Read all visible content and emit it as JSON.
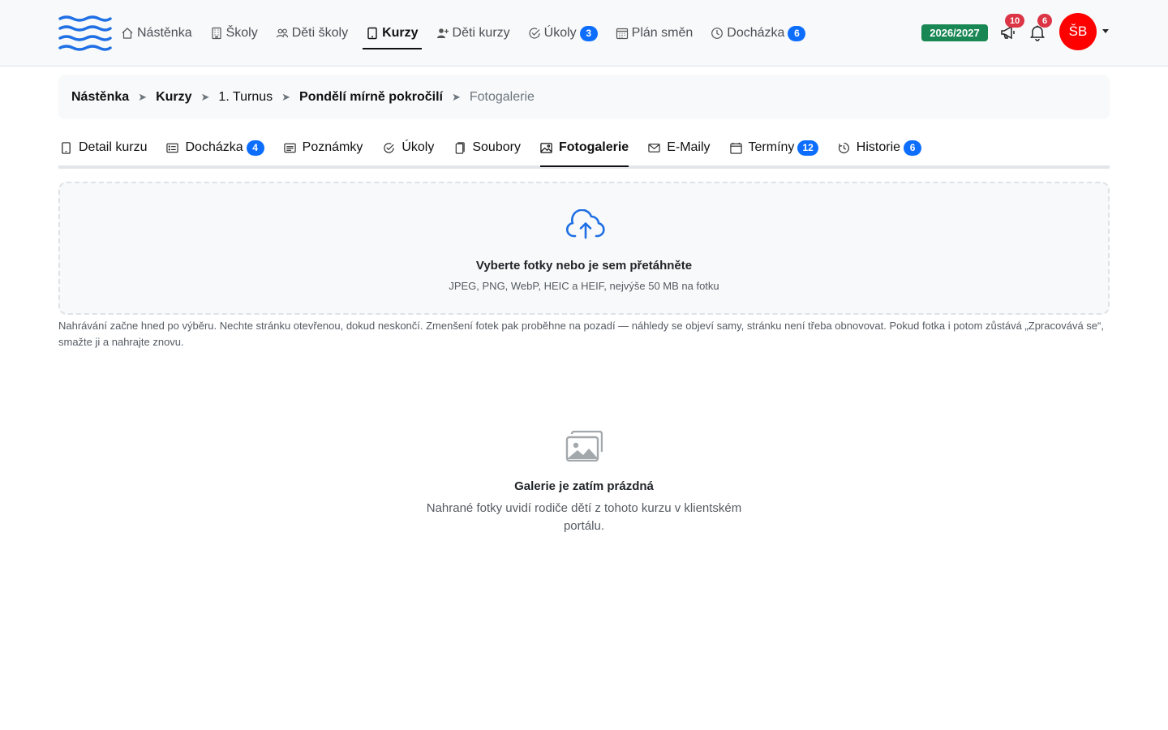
{
  "nav": {
    "items": [
      {
        "label": "Nástěnka",
        "icon": "house-icon"
      },
      {
        "label": "Školy",
        "icon": "building-icon"
      },
      {
        "label": "Děti školy",
        "icon": "people-icon"
      },
      {
        "label": "Kurzy",
        "icon": "tablet-icon",
        "active": true
      },
      {
        "label": "Děti kurzy",
        "icon": "person-plus-icon"
      },
      {
        "label": "Úkoly",
        "icon": "check-circle-icon",
        "badge": "3"
      },
      {
        "label": "Plán směn",
        "icon": "calendar-grid-icon"
      },
      {
        "label": "Docházka",
        "icon": "clock-icon",
        "badge": "6"
      }
    ],
    "year": "2026/2027",
    "announcements_count": "10",
    "notifications_count": "6",
    "avatar_initials": "ŠB"
  },
  "breadcrumb": [
    {
      "label": "Nástěnka"
    },
    {
      "label": "Kurzy"
    },
    {
      "label": "1. Turnus"
    },
    {
      "label": "Pondělí mírně pokročilí"
    },
    {
      "label": "Fotogalerie"
    }
  ],
  "tabs": [
    {
      "label": "Detail kurzu",
      "icon": "tablet-icon"
    },
    {
      "label": "Docházka",
      "icon": "card-list-icon",
      "badge": "4"
    },
    {
      "label": "Poznámky",
      "icon": "card-text-icon"
    },
    {
      "label": "Úkoly",
      "icon": "check-circle-icon"
    },
    {
      "label": "Soubory",
      "icon": "files-icon"
    },
    {
      "label": "Fotogalerie",
      "icon": "image-icon",
      "active": true
    },
    {
      "label": "E-Maily",
      "icon": "envelope-icon"
    },
    {
      "label": "Termíny",
      "icon": "calendar-icon",
      "badge": "12"
    },
    {
      "label": "Historie",
      "icon": "history-icon",
      "badge": "6"
    }
  ],
  "upload": {
    "title": "Vyberte fotky nebo je sem přetáhněte",
    "hint": "JPEG, PNG, WebP, HEIC a HEIF, nejvýše 50 MB na fotku",
    "help": "Nahrávání začne hned po výběru. Nechte stránku otevřenou, dokud neskončí. Zmenšení fotek pak proběhne na pozadí — náhledy se objeví samy, stránku není třeba obnovovat. Pokud fotka i potom zůstává „Zpracovává se“, smažte ji a nahrajte znovu."
  },
  "empty": {
    "title": "Galerie je zatím prázdná",
    "text": "Nahrané fotky uvidí rodiče dětí z tohoto kurzu v klientském portálu."
  },
  "colors": {
    "brand": "#1f6fe5",
    "badge_blue": "#0d6efd",
    "badge_red": "#dc3545",
    "year_green": "#198754",
    "avatar_red": "#ff0000"
  }
}
